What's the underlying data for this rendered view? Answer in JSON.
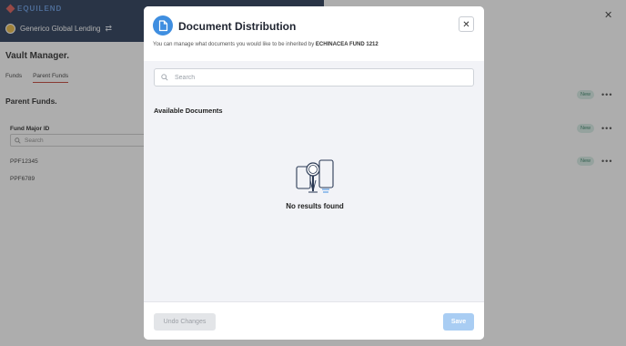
{
  "background": {
    "brand": "EQUILEND",
    "org_name": "Generico Global Lending",
    "page_title": "Vault Manager.",
    "tabs": [
      "Funds",
      "Parent Funds"
    ],
    "section_title": "Parent Funds.",
    "column_header": "Fund Major ID",
    "search_placeholder": "Search",
    "rows": [
      "PPF12345",
      "PPF6789"
    ],
    "badges": [
      "New",
      "New",
      "New"
    ]
  },
  "modal": {
    "title": "Document Distribution",
    "subtitle_prefix": "You can manage what documents you would like to be inherited by",
    "fund_name": "ECHINACEA FUND 1212",
    "search_placeholder": "Search",
    "section_label": "Available Documents",
    "empty_message": "No results found",
    "undo_label": "Undo Changes",
    "save_label": "Save"
  },
  "colors": {
    "primary": "#3f8ee0",
    "save_disabled": "#a9cdf3",
    "brand_bar": "#1c2f4f",
    "badge_bg": "#d6ede6"
  },
  "icons": {
    "modal": "document-icon",
    "close": "close-icon",
    "search": "search-icon",
    "empty": "empty-search-illustration"
  }
}
